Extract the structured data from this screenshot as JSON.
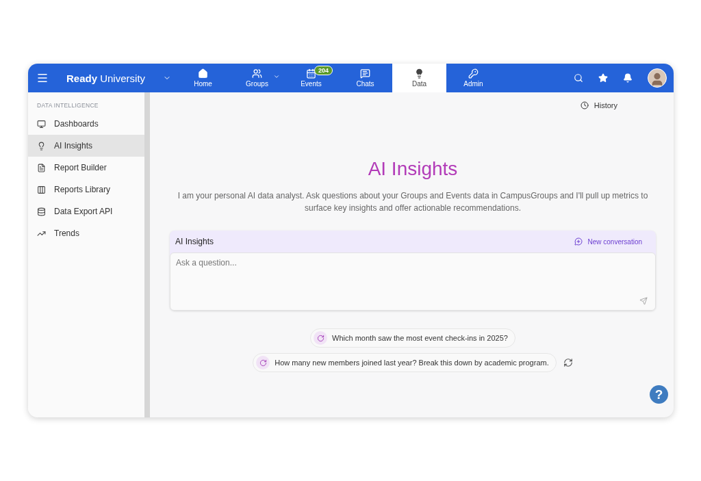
{
  "brand": {
    "name": "**Ready** University"
  },
  "nav": [
    {
      "label": "Home",
      "selected": false
    },
    {
      "label": "Groups",
      "selected": false,
      "has_menu": true
    },
    {
      "label": "Events",
      "selected": false,
      "badge": "204"
    },
    {
      "label": "Chats",
      "selected": false
    },
    {
      "label": "Data",
      "selected": true
    },
    {
      "label": "Admin",
      "selected": false
    }
  ],
  "sidebar": {
    "heading": "DATA INTELLIGENCE",
    "items": [
      {
        "label": "Dashboards",
        "selected": false
      },
      {
        "label": "AI Insights",
        "selected": true
      },
      {
        "label": "Report Builder",
        "selected": false
      },
      {
        "label": "Reports Library",
        "selected": false
      },
      {
        "label": "Data Export API",
        "selected": false
      },
      {
        "label": "Trends",
        "selected": false
      }
    ]
  },
  "history": "History",
  "title": "AI Insights",
  "intro": "I am your personal AI data analyst. Ask questions about your Groups and Events data in CampusGroups and I'll pull up metrics to surface key insights and offer actionable recommendations.",
  "chat": {
    "title": "AI Insights",
    "new_conversation": "New conversation",
    "placeholder": "Ask a question..."
  },
  "suggestions": [
    "Which month saw the most event check-ins in 2025?",
    "How many new members joined last year? Break this down by academic program."
  ],
  "help": "?"
}
